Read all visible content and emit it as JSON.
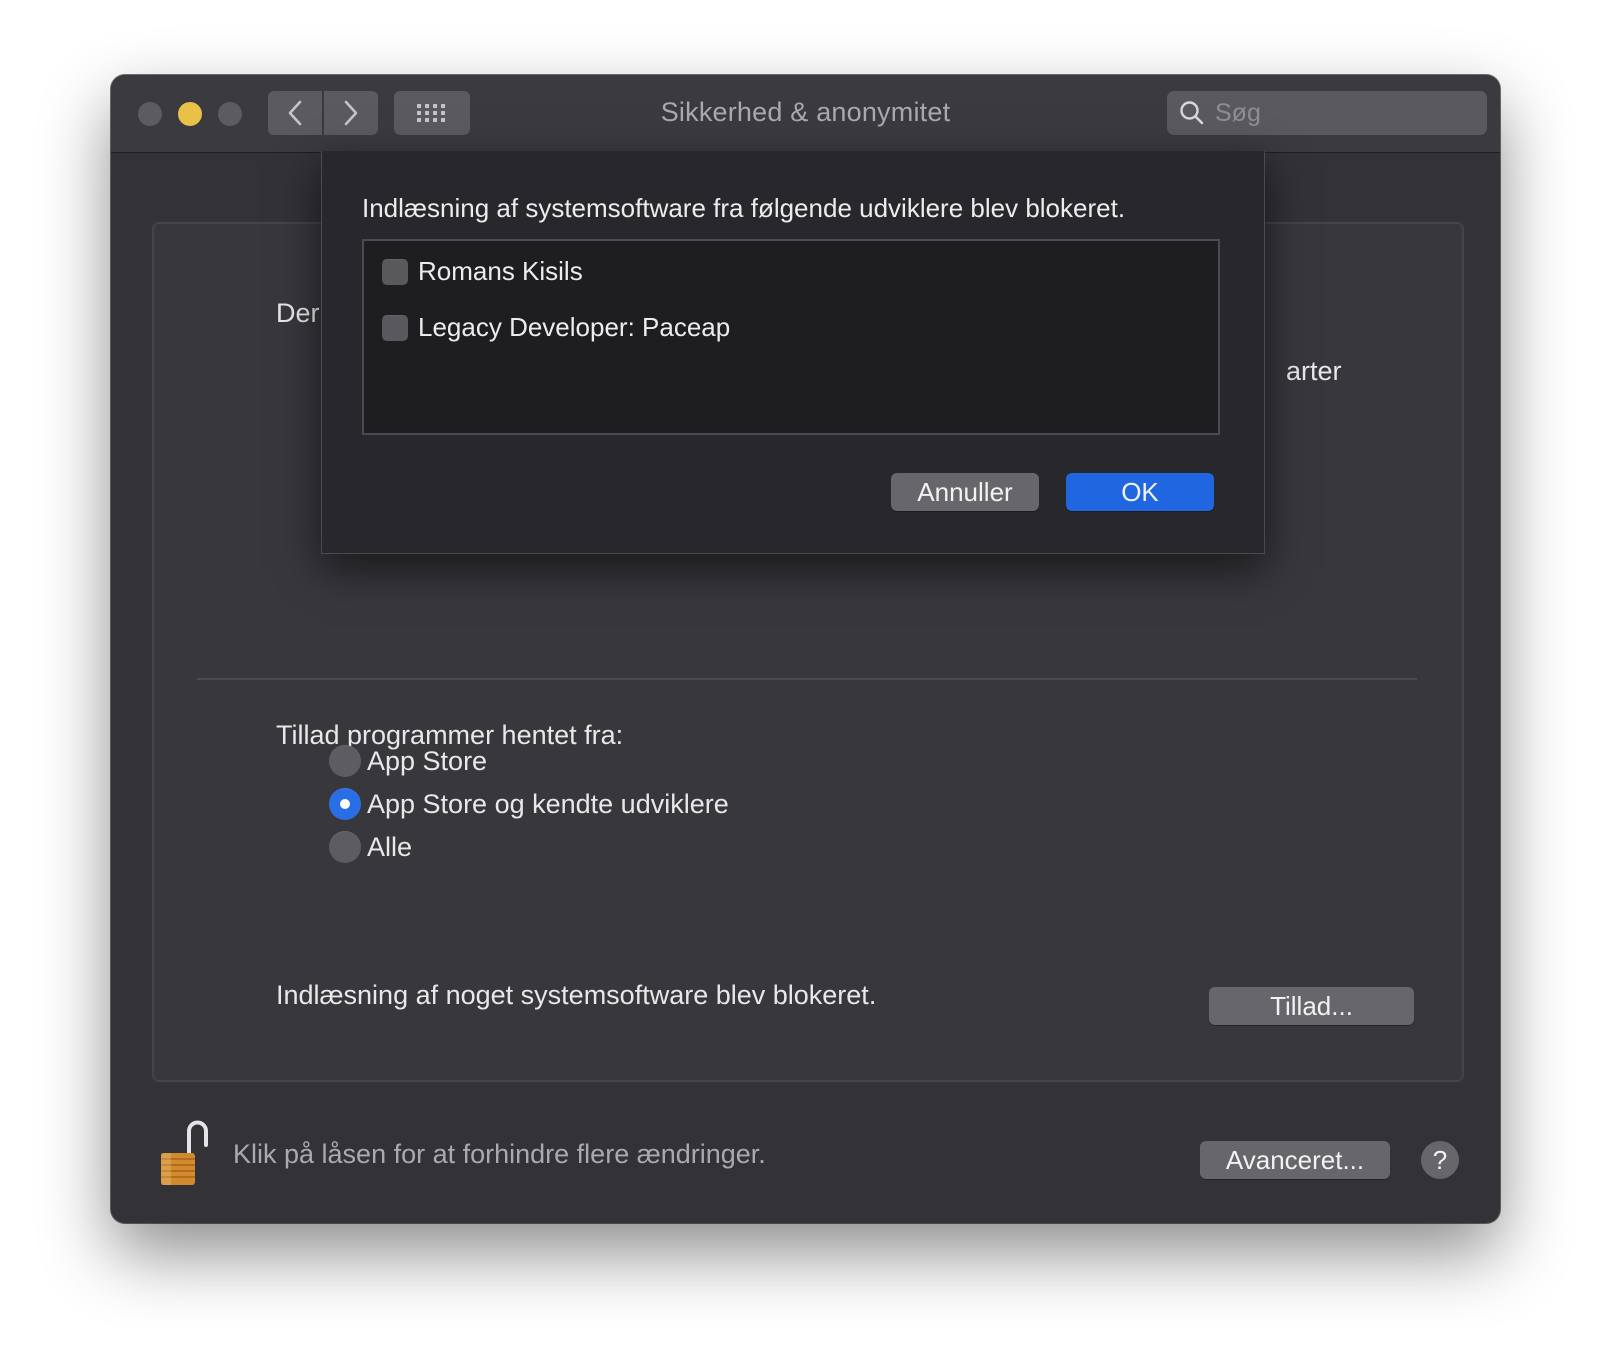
{
  "window": {
    "title": "Sikkerhed & anonymitet",
    "search_placeholder": "Søg"
  },
  "panel": {
    "partial_text_left": "Der",
    "partial_text_right": "arter",
    "allow_apps_label": "Tillad programmer hentet fra:",
    "radio_options": [
      {
        "label": "App Store",
        "selected": false
      },
      {
        "label": "App Store og kendte udviklere",
        "selected": true
      },
      {
        "label": "Alle",
        "selected": false
      }
    ],
    "blocked_text": "Indlæsning af noget systemsoftware blev blokeret.",
    "allow_button": "Tillad..."
  },
  "footer": {
    "lock_text": "Klik på låsen for at forhindre flere ændringer.",
    "advanced_button": "Avanceret...",
    "help_button": "?"
  },
  "sheet": {
    "title": "Indlæsning af systemsoftware fra følgende udviklere blev blokeret.",
    "developers": [
      {
        "label": "Romans Kisils",
        "checked": false
      },
      {
        "label": "Legacy Developer: Paceap",
        "checked": false
      }
    ],
    "cancel_button": "Annuller",
    "ok_button": "OK"
  },
  "colors": {
    "accent": "#1f66e0",
    "window_bg": "#323237",
    "minimize": "#e9c048"
  },
  "icons": [
    "back-chevron-icon",
    "forward-chevron-icon",
    "grid-icon",
    "search-icon",
    "lock-open-icon"
  ]
}
